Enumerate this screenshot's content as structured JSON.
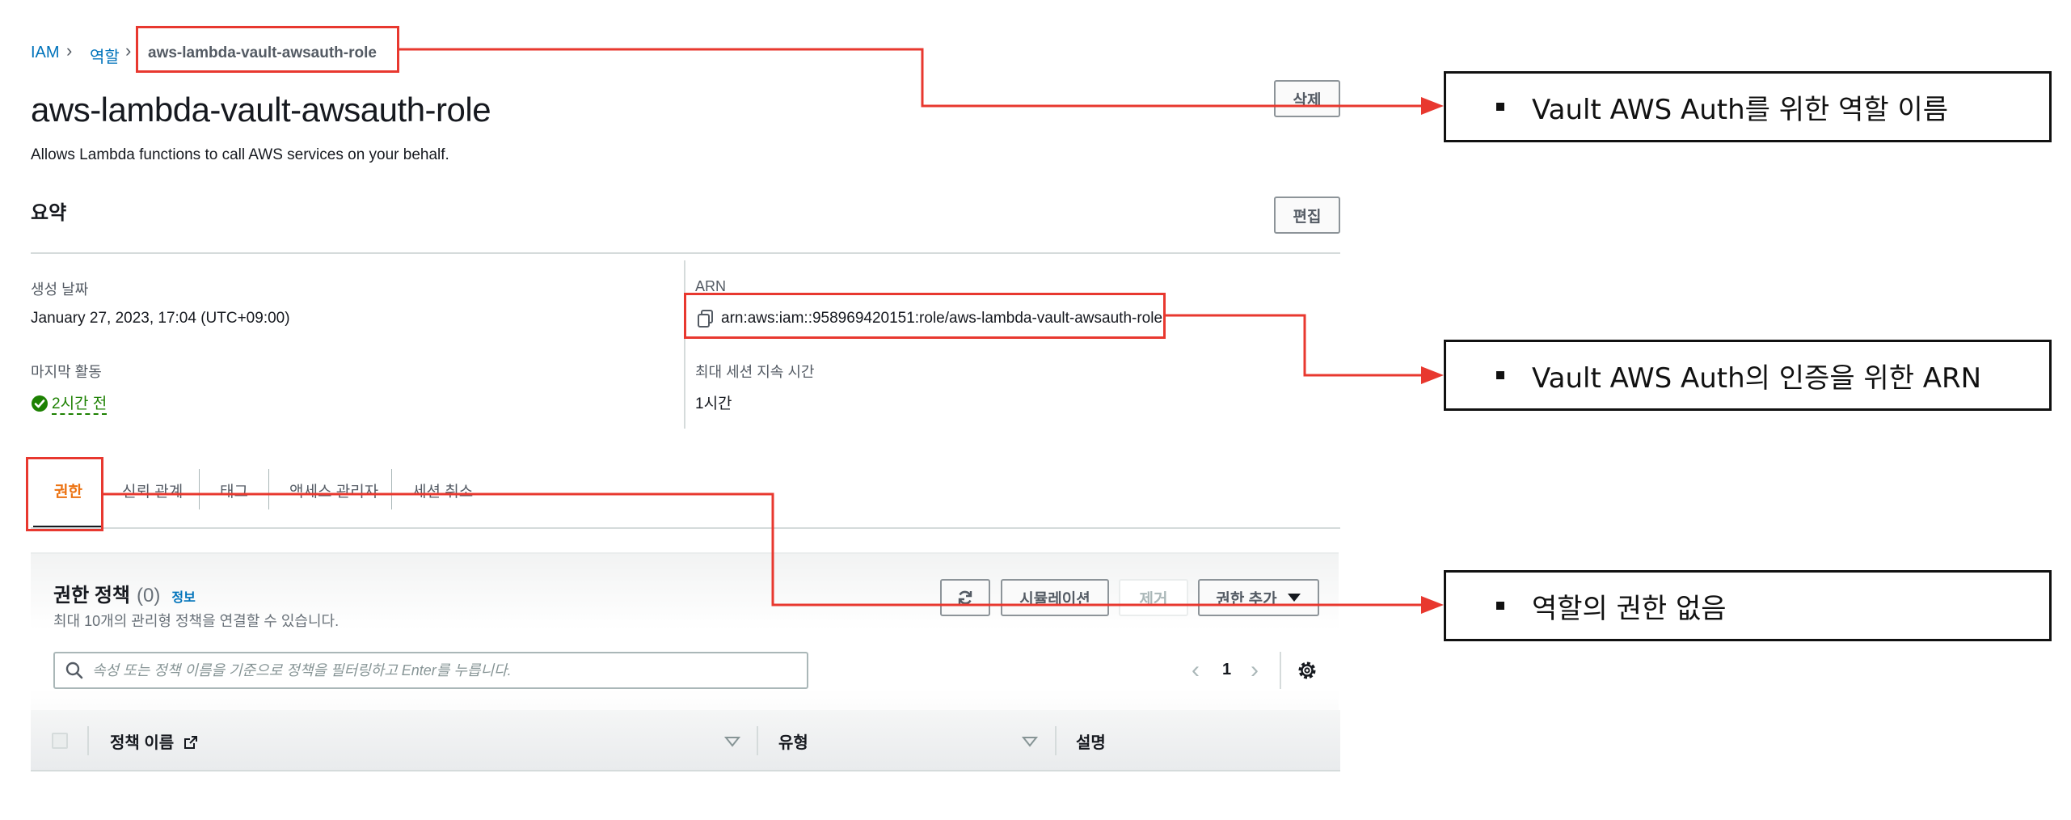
{
  "breadcrumb": {
    "root": "IAM",
    "parent": "역할",
    "current": "aws-lambda-vault-awsauth-role"
  },
  "role": {
    "title": "aws-lambda-vault-awsauth-role",
    "description": "Allows Lambda functions to call AWS services on your behalf."
  },
  "actions": {
    "delete_label": "삭제",
    "edit_label": "편집"
  },
  "summary": {
    "heading": "요약",
    "created_label": "생성 날짜",
    "created_value": "January 27, 2023, 17:04 (UTC+09:00)",
    "arn_label": "ARN",
    "arn_value": "arn:aws:iam::958969420151:role/aws-lambda-vault-awsauth-role",
    "last_activity_label": "마지막 활동",
    "last_activity_value": "2시간 전",
    "max_session_label": "최대 세션 지속 시간",
    "max_session_value": "1시간"
  },
  "tabs": [
    {
      "label": "권한",
      "active": true
    },
    {
      "label": "신뢰 관계"
    },
    {
      "label": "태그"
    },
    {
      "label": "액세스 관리자"
    },
    {
      "label": "세션 취소"
    }
  ],
  "permissions": {
    "title": "권한 정책",
    "count": "(0)",
    "info_label": "정보",
    "subtitle": "최대 10개의 관리형 정책을 연결할 수 있습니다.",
    "simulate_label": "시뮬레이션",
    "remove_label": "제거",
    "add_label": "권한 추가",
    "search_placeholder": "속성 또는 정책 이름을 기준으로 정책을 필터링하고 Enter를 누릅니다.",
    "page_number": "1",
    "columns": [
      "정책 이름",
      "유형",
      "설명"
    ]
  },
  "annotations": {
    "role_name_note": "Vault AWS Auth를 위한 역할 이름",
    "arn_note": "Vault AWS Auth의 인증을 위한 ARN",
    "permission_note": "역할의 권한 없음"
  },
  "colors": {
    "link_blue": "#0073bb",
    "active_tab_orange": "#ec7211",
    "success_green": "#1d8102",
    "annotation_red": "#e8382f"
  }
}
